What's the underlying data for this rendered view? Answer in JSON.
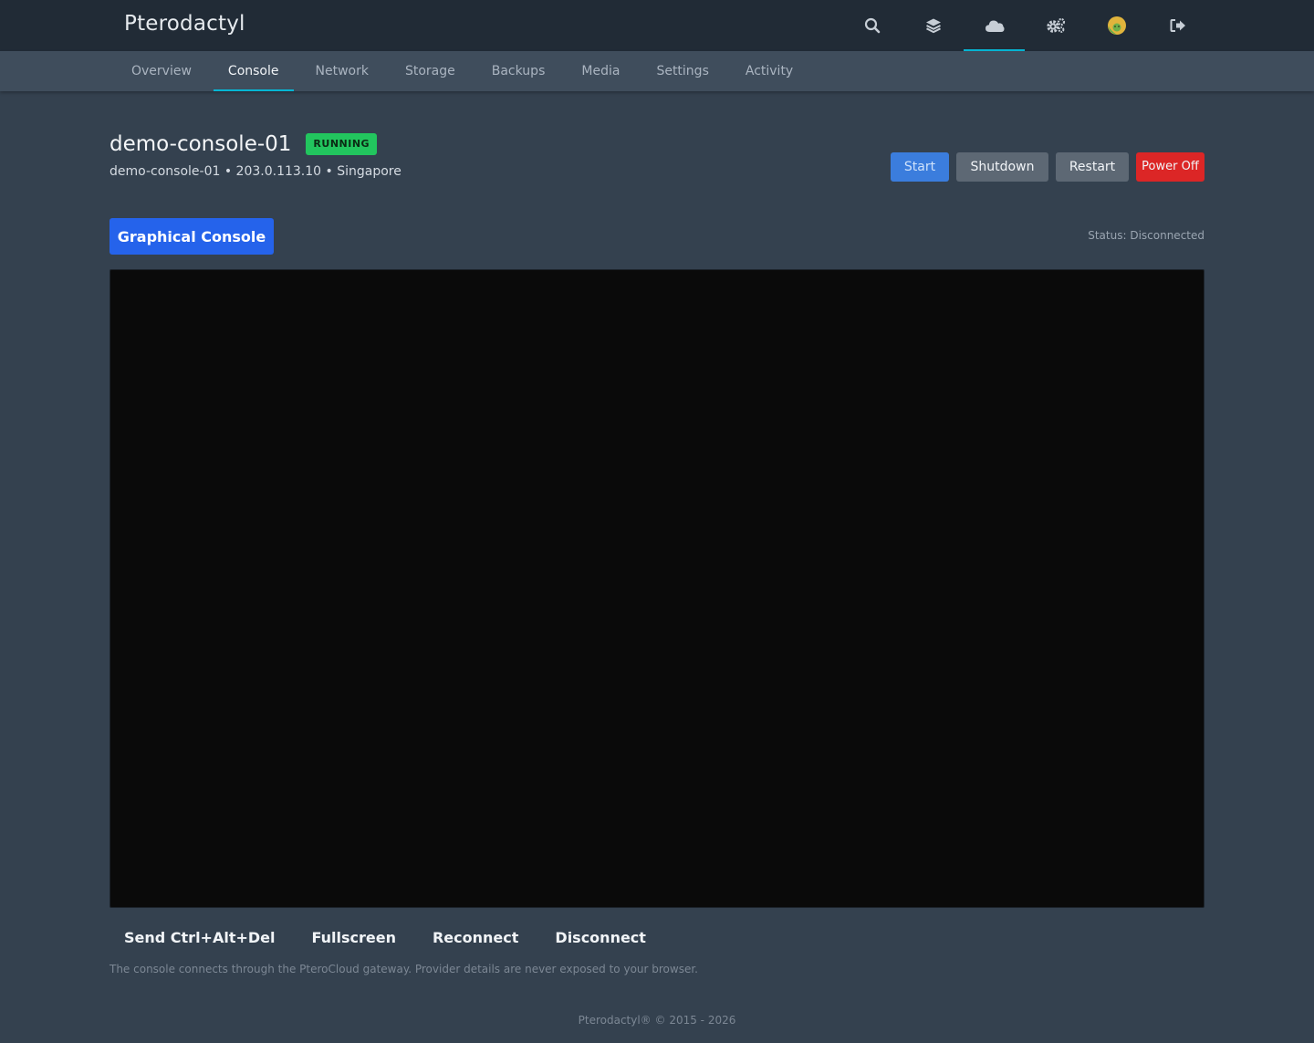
{
  "app": {
    "brand": "Pterodactyl"
  },
  "topbar": {
    "icons": [
      {
        "name": "search-icon",
        "active": false
      },
      {
        "name": "layers-icon",
        "active": false
      },
      {
        "name": "cloud-icon",
        "active": true
      },
      {
        "name": "gears-icon",
        "active": false
      },
      {
        "name": "avatar",
        "active": false
      },
      {
        "name": "sign-out-icon",
        "active": false
      }
    ]
  },
  "subnav": {
    "tabs": [
      {
        "label": "Overview",
        "active": false
      },
      {
        "label": "Console",
        "active": true
      },
      {
        "label": "Network",
        "active": false
      },
      {
        "label": "Storage",
        "active": false
      },
      {
        "label": "Backups",
        "active": false
      },
      {
        "label": "Media",
        "active": false
      },
      {
        "label": "Settings",
        "active": false
      },
      {
        "label": "Activity",
        "active": false
      }
    ]
  },
  "server": {
    "title": "demo-console-01",
    "status_badge": "RUNNING",
    "subtitle": "demo-console-01 • 203.0.113.10 • Singapore"
  },
  "power": {
    "start_label": "Start",
    "shutdown_label": "Shutdown",
    "restart_label": "Restart",
    "poweroff_label": "Power Off"
  },
  "console": {
    "graphical_label": "Graphical Console",
    "status": "Status: Disconnected",
    "actions": {
      "ctrl_alt_del": "Send Ctrl+Alt+Del",
      "fullscreen": "Fullscreen",
      "reconnect": "Reconnect",
      "disconnect": "Disconnect"
    },
    "note": "The console connects through the PteroCloud gateway. Provider details are never exposed to your browser."
  },
  "footer": {
    "text": "Pterodactyl® © 2015 - 2026"
  },
  "colors": {
    "accent": "#06b6d4",
    "primary": "#2563eb",
    "success": "#22c55e",
    "danger": "#dc2626"
  }
}
